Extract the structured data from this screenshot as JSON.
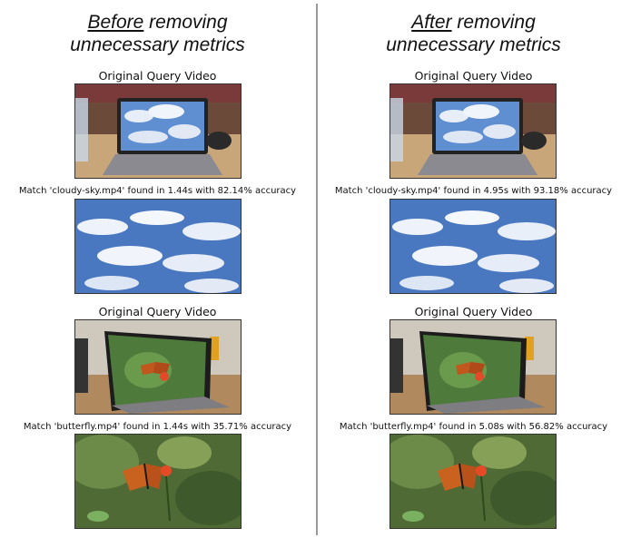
{
  "panels": [
    {
      "heading_emph": "Before",
      "heading_rest1": " removing",
      "heading_line2": "unnecessary metrics",
      "query_label_1": "Original Query Video",
      "match_1": "Match 'cloudy-sky.mp4' found in 1.44s with 82.14% accuracy",
      "query_label_2": "Original Query Video",
      "match_2": "Match 'butterfly.mp4' found in 1.44s with 35.71% accuracy"
    },
    {
      "heading_emph": "After",
      "heading_rest1": " removing",
      "heading_line2": "unnecessary metrics",
      "query_label_1": "Original Query Video",
      "match_1": "Match 'cloudy-sky.mp4' found in 4.95s with 93.18% accuracy",
      "query_label_2": "Original Query Video",
      "match_2": "Match 'butterfly.mp4' found in 5.08s with 56.82% accuracy"
    }
  ]
}
